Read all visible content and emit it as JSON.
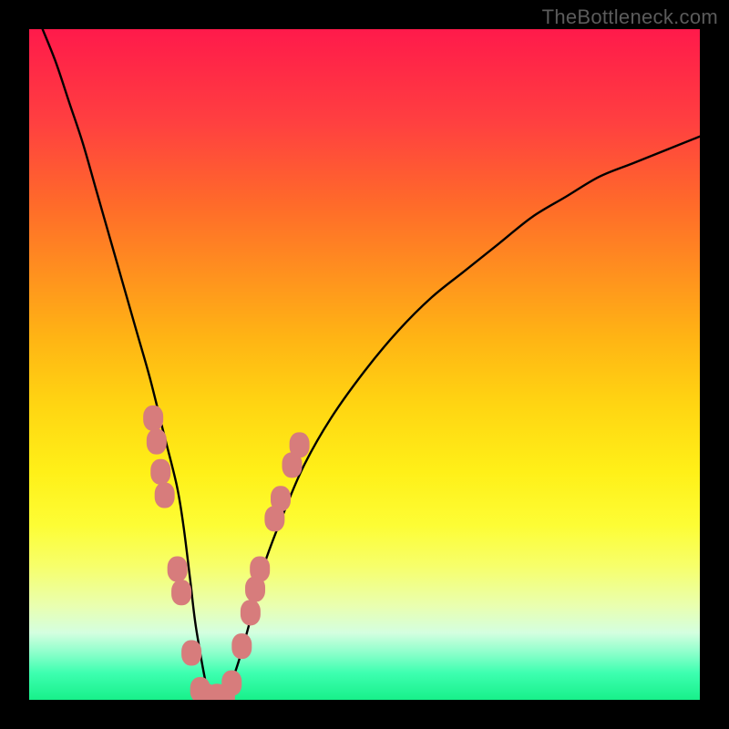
{
  "attribution": "TheBottleneck.com",
  "chart_data": {
    "type": "line",
    "title": "",
    "xlabel": "",
    "ylabel": "",
    "xlim": [
      0,
      100
    ],
    "ylim": [
      0,
      100
    ],
    "series": [
      {
        "name": "bottleneck-curve",
        "x": [
          2,
          4,
          6,
          8,
          10,
          12,
          14,
          16,
          18,
          20,
          22,
          23,
          24,
          25,
          27,
          29,
          31,
          33,
          35,
          38,
          41,
          45,
          50,
          55,
          60,
          65,
          70,
          75,
          80,
          85,
          90,
          95,
          100
        ],
        "values": [
          100,
          95,
          89,
          83,
          76,
          69,
          62,
          55,
          48,
          40,
          32,
          26,
          18,
          10,
          0,
          0,
          5,
          12,
          20,
          28,
          35,
          42,
          49,
          55,
          60,
          64,
          68,
          72,
          75,
          78,
          80,
          82,
          84
        ]
      }
    ],
    "markers": {
      "name": "highlight-points",
      "color": "#d77c7c",
      "points": [
        {
          "x": 18.5,
          "y": 42
        },
        {
          "x": 19,
          "y": 38.5
        },
        {
          "x": 19.6,
          "y": 34
        },
        {
          "x": 20.2,
          "y": 30.5
        },
        {
          "x": 22.1,
          "y": 19.5
        },
        {
          "x": 22.7,
          "y": 16
        },
        {
          "x": 24.2,
          "y": 7
        },
        {
          "x": 25.5,
          "y": 1.5
        },
        {
          "x": 26.5,
          "y": 0.5
        },
        {
          "x": 28,
          "y": 0.5
        },
        {
          "x": 29.2,
          "y": 0.5
        },
        {
          "x": 30.2,
          "y": 2.5
        },
        {
          "x": 31.7,
          "y": 8
        },
        {
          "x": 33,
          "y": 13
        },
        {
          "x": 33.7,
          "y": 16.5
        },
        {
          "x": 34.4,
          "y": 19.5
        },
        {
          "x": 36.6,
          "y": 27
        },
        {
          "x": 37.5,
          "y": 30
        },
        {
          "x": 39.2,
          "y": 35
        },
        {
          "x": 40.3,
          "y": 38
        }
      ]
    }
  }
}
